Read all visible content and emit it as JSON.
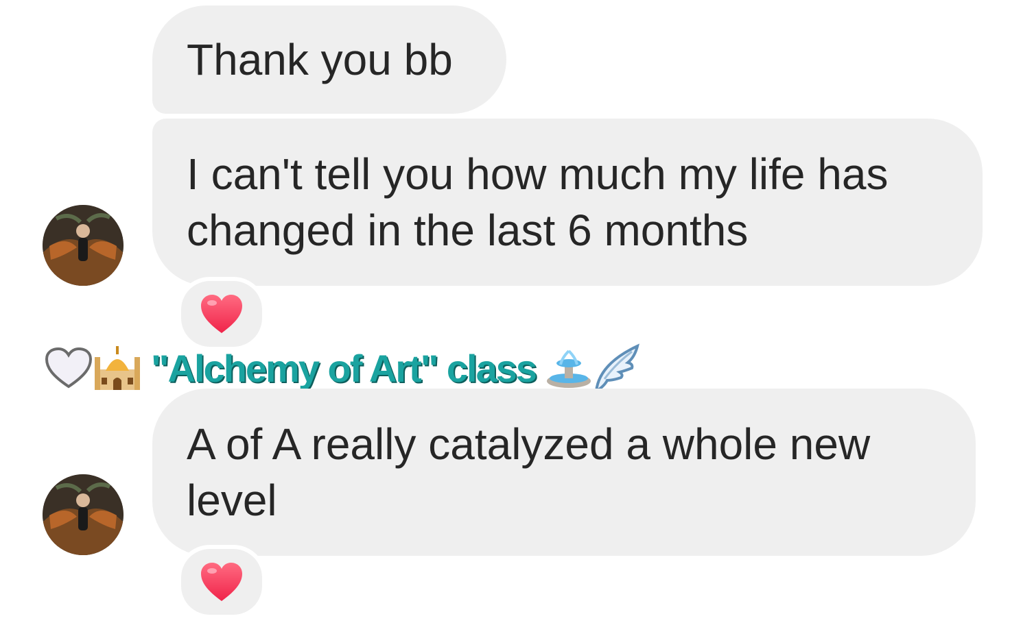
{
  "messages": [
    {
      "text": "Thank you bb"
    },
    {
      "text": "I can't tell you how much my life has\nchanged in the last 6 months",
      "reaction": "red-heart-icon"
    },
    {
      "text": "A of A really catalyzed a whole new\nlevel",
      "reaction": "red-heart-icon"
    }
  ],
  "reply_header": {
    "text": "\"Alchemy of Art\" class",
    "leading_icons": [
      "white-heart-icon",
      "mosque-icon"
    ],
    "trailing_icons": [
      "fountain-icon",
      "wing-icon"
    ]
  },
  "colors": {
    "bubble": "#efefef",
    "text": "#262626",
    "event_text": "#1aa3a0",
    "heart": "#ff3b5c"
  }
}
